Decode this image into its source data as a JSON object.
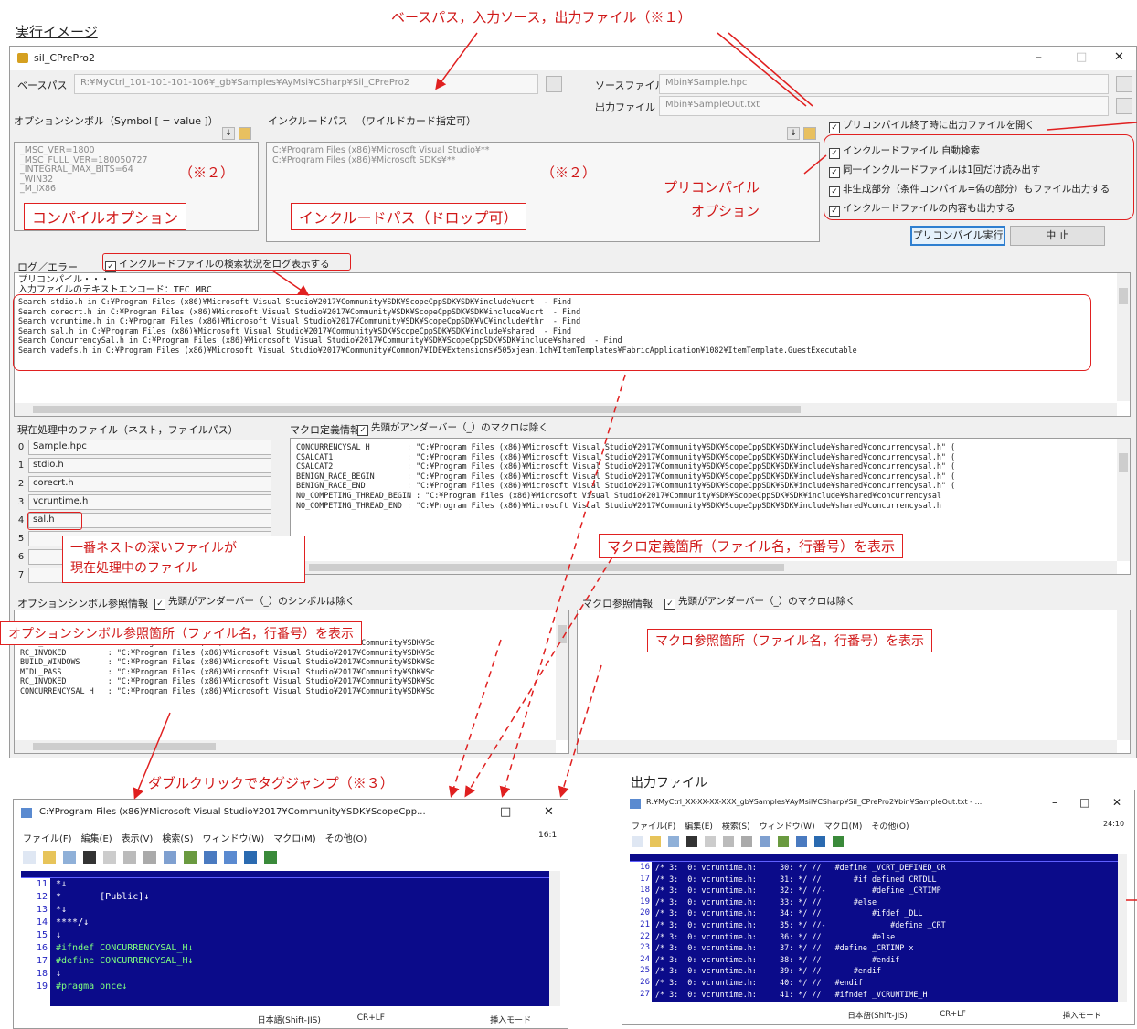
{
  "caption_title": "実行イメージ",
  "window": {
    "title": "sil_CPrePro2",
    "minimize": "–",
    "restore": "□",
    "close": "✕"
  },
  "base_path": {
    "label": "ベースパス",
    "value": "R:¥MyCtrl_101-101-101-106¥_gb¥Samples¥AyMsi¥CSharp¥Sil_CPrePro2"
  },
  "source_file": {
    "label": "ソースファイル",
    "value": "Mbin¥Sample.hpc"
  },
  "output_file": {
    "label": "出力ファイル",
    "value": "Mbin¥SampleOut.txt"
  },
  "option_symbols": {
    "label": "オプションシンボル（Symbol [ = value ]）",
    "items": [
      "_MSC_VER=1800",
      "_MSC_FULL_VER=180050727",
      "_INTEGRAL_MAX_BITS=64",
      "_WIN32",
      "_M_IX86"
    ]
  },
  "include_paths": {
    "label": "インクルードパス",
    "hint": "（ワイルドカード指定可）",
    "items": [
      "C:¥Program Files (x86)¥Microsoft Visual Studio¥**",
      "C:¥Program Files (x86)¥Microsoft SDKs¥**"
    ]
  },
  "precompile_options": {
    "close_after": "プリコンパイル終了時に出力ファイルを開く",
    "items": [
      "インクルードファイル 自動検索",
      "同一インクルードファイルは1回だけ読み出す",
      "非生成部分（条件コンパイル=偽の部分）もファイル出力する",
      "インクルードファイルの内容も出力する"
    ]
  },
  "buttons": {
    "run": "プリコンパイル実行",
    "stop": "中 止"
  },
  "log": {
    "label": "ログ／エラー",
    "show_include_search": "インクルードファイルの検索状況をログ表示する",
    "header_lines": [
      "プリコンパイル・・・",
      "入力ファイルのテキストエンコード：TEC_MBC"
    ],
    "lines": [
      "Search stdio.h in C:¥Program Files (x86)¥Microsoft Visual Studio¥2017¥Community¥SDK¥ScopeCppSDK¥SDK¥include¥ucrt  - Find",
      "Search corecrt.h in C:¥Program Files (x86)¥Microsoft Visual Studio¥2017¥Community¥SDK¥ScopeCppSDK¥SDK¥include¥ucrt  - Find",
      "Search vcruntime.h in C:¥Program Files (x86)¥Microsoft Visual Studio¥2017¥Community¥SDK¥ScopeCppSDK¥VC¥include¥thr  - Find",
      "Search sal.h in C:¥Program Files (x86)¥Microsoft Visual Studio¥2017¥Community¥SDK¥ScopeCppSDK¥SDK¥include¥shared  - Find",
      "Search ConcurrencySal.h in C:¥Program Files (x86)¥Microsoft Visual Studio¥2017¥Community¥SDK¥ScopeCppSDK¥SDK¥include¥shared  - Find",
      "Search vadefs.h in C:¥Program Files (x86)¥Microsoft Visual Studio¥2017¥Community¥Common7¥IDE¥Extensions¥505xjean.1ch¥ItemTemplates¥FabricApplication¥1082¥ItemTemplate.GuestExecutable"
    ]
  },
  "current_files": {
    "label": "現在処理中のファイル（ネスト，ファイルパス）",
    "rows": [
      {
        "index": "0",
        "name": "Sample.hpc"
      },
      {
        "index": "1",
        "name": "stdio.h"
      },
      {
        "index": "2",
        "name": "corecrt.h"
      },
      {
        "index": "3",
        "name": "vcruntime.h"
      },
      {
        "index": "4",
        "name": "sal.h"
      },
      {
        "index": "5",
        "name": ""
      },
      {
        "index": "6",
        "name": ""
      },
      {
        "index": "7",
        "name": ""
      }
    ]
  },
  "macro_def": {
    "label": "マクロ定義情報",
    "exclude_underscore": "先頭がアンダーバー（_）のマクロは除く",
    "lines": [
      "CONCURRENCYSAL_H        : \"C:¥Program Files (x86)¥Microsoft Visual Studio¥2017¥Community¥SDK¥ScopeCppSDK¥SDK¥include¥shared¥concurrencysal.h\" (",
      "CSALCAT1                : \"C:¥Program Files (x86)¥Microsoft Visual Studio¥2017¥Community¥SDK¥ScopeCppSDK¥SDK¥include¥shared¥concurrencysal.h\" (",
      "CSALCAT2                : \"C:¥Program Files (x86)¥Microsoft Visual Studio¥2017¥Community¥SDK¥ScopeCppSDK¥SDK¥include¥shared¥concurrencysal.h\" (",
      "BENIGN_RACE_BEGIN       : \"C:¥Program Files (x86)¥Microsoft Visual Studio¥2017¥Community¥SDK¥ScopeCppSDK¥SDK¥include¥shared¥concurrencysal.h\" (",
      "BENIGN_RACE_END         : \"C:¥Program Files (x86)¥Microsoft Visual Studio¥2017¥Community¥SDK¥ScopeCppSDK¥SDK¥include¥shared¥concurrencysal.h\" (",
      "NO_COMPETING_THREAD_BEGIN : \"C:¥Program Files (x86)¥Microsoft Visual Studio¥2017¥Community¥SDK¥ScopeCppSDK¥SDK¥include¥shared¥concurrencysal",
      "NO_COMPETING_THREAD_END : \"C:¥Program Files (x86)¥Microsoft Visual Studio¥2017¥Community¥SDK¥ScopeCppSDK¥SDK¥include¥shared¥concurrencysal.h"
    ]
  },
  "option_symbol_ref": {
    "label": "オプションシンボル参照情報",
    "exclude_underscore": "先頭がアンダーバー（_）のシンボルは除く",
    "lines": [
      "MIDL_PASS          : \"C:¥Program Files (x86)¥Microsoft Visual Studio¥2017¥Community¥SDK¥Sc",
      "RC_INVOKED         : \"C:¥Program Files (x86)¥Microsoft Visual Studio¥2017¥Community¥SDK¥Sc",
      "BUILD_WINDOWS      : \"C:¥Program Files (x86)¥Microsoft Visual Studio¥2017¥Community¥SDK¥Sc",
      "MIDL_PASS          : \"C:¥Program Files (x86)¥Microsoft Visual Studio¥2017¥Community¥SDK¥Sc",
      "RC_INVOKED         : \"C:¥Program Files (x86)¥Microsoft Visual Studio¥2017¥Community¥SDK¥Sc",
      "CONCURRENCYSAL_H   : \"C:¥Program Files (x86)¥Microsoft Visual Studio¥2017¥Community¥SDK¥Sc"
    ]
  },
  "macro_ref": {
    "label": "マクロ参照情報",
    "exclude_underscore": "先頭がアンダーバー（_）のマクロは除く"
  },
  "annotations": {
    "top": "ベースパス，入力ソース，出力ファイル（※１）",
    "note2a": "（※２）",
    "note2b": "（※２）",
    "compile_option": "コンパイルオプション",
    "include_path": "インクルードパス（ドロップ可）",
    "precompile_option_1": "プリコンパイル",
    "precompile_option_2": "オプション",
    "nest_1": "一番ネストの深いファイルが",
    "nest_2": "現在処理中のファイル",
    "macro_def_loc": "マクロ定義箇所（ファイル名，行番号）を表示",
    "option_ref_loc": "オプションシンボル参照箇所（ファイル名，行番号）を表示",
    "macro_ref_loc": "マクロ参照箇所（ファイル名，行番号）を表示",
    "tag_jump": "ダブルクリックでタグジャンプ（※３）",
    "output_file": "出力ファイル"
  },
  "editor1": {
    "title": "C:¥Program Files (x86)¥Microsoft Visual Studio¥2017¥Community¥SDK¥ScopeCpp...",
    "menu": [
      "ファイル(F)",
      "編集(E)",
      "表示(V)",
      "検索(S)",
      "ウィンドウ(W)",
      "マクロ(M)",
      "その他(O)"
    ],
    "tab_info": "16:1",
    "line_numbers": [
      "11",
      "12",
      "13",
      "14",
      "15",
      "16",
      "17",
      "18",
      "19"
    ],
    "lines": [
      "*↓",
      "*       [Public]↓",
      "*↓",
      "****/↓",
      "↓",
      "#ifndef CONCURRENCYSAL_H↓",
      "#define CONCURRENCYSAL_H↓",
      "↓",
      "#pragma once↓"
    ],
    "status": [
      "日本語(Shift-JIS)",
      "CR+LF",
      "挿入モード"
    ]
  },
  "editor2": {
    "title": "R:¥MyCtrl_XX-XX-XX-XXX_gb¥Samples¥AyMsil¥CSharp¥Sil_CPrePro2¥bin¥SampleOut.txt - ...",
    "menu": [
      "ファイル(F)",
      "編集(E)",
      "検索(S)",
      "ウィンドウ(W)",
      "マクロ(M)",
      "その他(O)"
    ],
    "tab_info": "24:10",
    "line_numbers": [
      "16",
      "17",
      "18",
      "19",
      "20",
      "21",
      "22",
      "23",
      "24",
      "25",
      "26",
      "27"
    ],
    "lines": [
      "/* 3:  0: vcruntime.h:     30: */ //   #define _VCRT_DEFINED_CR",
      "/* 3:  0: vcruntime.h:     31: */ //       #if defined CRTDLL",
      "/* 3:  0: vcruntime.h:     32: */ //-          #define _CRTIMP",
      "/* 3:  0: vcruntime.h:     33: */ //       #else",
      "/* 3:  0: vcruntime.h:     34: */ //           #ifdef _DLL",
      "/* 3:  0: vcruntime.h:     35: */ //-              #define _CRT",
      "/* 3:  0: vcruntime.h:     36: */ //           #else",
      "/* 3:  0: vcruntime.h:     37: */ //   #define _CRTIMP x",
      "/* 3:  0: vcruntime.h:     38: */ //           #endif",
      "/* 3:  0: vcruntime.h:     39: */ //       #endif",
      "/* 3:  0: vcruntime.h:     40: */ //   #endif",
      "/* 3:  0: vcruntime.h:     41: */ //   #ifndef _VCRUNTIME_H"
    ],
    "status": [
      "日本語(Shift-JIS)",
      "CR+LF",
      "挿入モード"
    ]
  }
}
